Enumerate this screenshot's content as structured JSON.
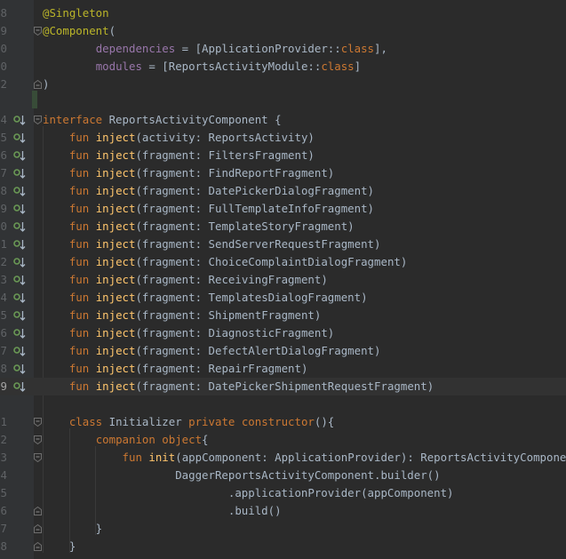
{
  "editor": {
    "lines": [
      {
        "num": "8",
        "tokens": [
          {
            "t": "@Singleton",
            "c": "anno"
          }
        ]
      },
      {
        "num": "9",
        "fold": "top",
        "tokens": [
          {
            "t": "@Component",
            "c": "anno"
          },
          {
            "t": "(",
            "c": "plain"
          }
        ]
      },
      {
        "num": "0",
        "tokens": [
          {
            "t": "        ",
            "c": "plain"
          },
          {
            "t": "dependencies",
            "c": "prop"
          },
          {
            "t": " = [ApplicationProvider::",
            "c": "plain"
          },
          {
            "t": "class",
            "c": "kw"
          },
          {
            "t": "],",
            "c": "plain"
          }
        ]
      },
      {
        "num": "0",
        "tokens": [
          {
            "t": "        ",
            "c": "plain"
          },
          {
            "t": "modules",
            "c": "prop"
          },
          {
            "t": " = [ReportsActivityModule::",
            "c": "plain"
          },
          {
            "t": "class",
            "c": "kw"
          },
          {
            "t": "]",
            "c": "plain"
          }
        ]
      },
      {
        "num": "2",
        "fold": "bottom",
        "tokens": [
          {
            "t": ")",
            "c": "plain"
          }
        ]
      },
      {
        "num": "",
        "tokens": []
      },
      {
        "num": "4",
        "impl": true,
        "fold": "top",
        "tokens": [
          {
            "t": "interface",
            "c": "kw"
          },
          {
            "t": " ReportsActivityComponent {",
            "c": "plain"
          }
        ]
      },
      {
        "num": "5",
        "impl": true,
        "tokens": [
          {
            "t": "    ",
            "c": "plain"
          },
          {
            "t": "fun",
            "c": "kw"
          },
          {
            "t": " ",
            "c": "plain"
          },
          {
            "t": "inject",
            "c": "fn"
          },
          {
            "t": "(activity: ReportsActivity)",
            "c": "plain"
          }
        ]
      },
      {
        "num": "6",
        "impl": true,
        "tokens": [
          {
            "t": "    ",
            "c": "plain"
          },
          {
            "t": "fun",
            "c": "kw"
          },
          {
            "t": " ",
            "c": "plain"
          },
          {
            "t": "inject",
            "c": "fn"
          },
          {
            "t": "(fragment: FiltersFragment)",
            "c": "plain"
          }
        ]
      },
      {
        "num": "7",
        "impl": true,
        "tokens": [
          {
            "t": "    ",
            "c": "plain"
          },
          {
            "t": "fun",
            "c": "kw"
          },
          {
            "t": " ",
            "c": "plain"
          },
          {
            "t": "inject",
            "c": "fn"
          },
          {
            "t": "(fragment: FindReportFragment)",
            "c": "plain"
          }
        ]
      },
      {
        "num": "8",
        "impl": true,
        "tokens": [
          {
            "t": "    ",
            "c": "plain"
          },
          {
            "t": "fun",
            "c": "kw"
          },
          {
            "t": " ",
            "c": "plain"
          },
          {
            "t": "inject",
            "c": "fn"
          },
          {
            "t": "(fragment: DatePickerDialogFragment)",
            "c": "plain"
          }
        ]
      },
      {
        "num": "9",
        "impl": true,
        "tokens": [
          {
            "t": "    ",
            "c": "plain"
          },
          {
            "t": "fun",
            "c": "kw"
          },
          {
            "t": " ",
            "c": "plain"
          },
          {
            "t": "inject",
            "c": "fn"
          },
          {
            "t": "(fragment: FullTemplateInfoFragment)",
            "c": "plain"
          }
        ]
      },
      {
        "num": "0",
        "impl": true,
        "tokens": [
          {
            "t": "    ",
            "c": "plain"
          },
          {
            "t": "fun",
            "c": "kw"
          },
          {
            "t": " ",
            "c": "plain"
          },
          {
            "t": "inject",
            "c": "fn"
          },
          {
            "t": "(fragment: TemplateStoryFragment)",
            "c": "plain"
          }
        ]
      },
      {
        "num": "1",
        "impl": true,
        "tokens": [
          {
            "t": "    ",
            "c": "plain"
          },
          {
            "t": "fun",
            "c": "kw"
          },
          {
            "t": " ",
            "c": "plain"
          },
          {
            "t": "inject",
            "c": "fn"
          },
          {
            "t": "(fragment: SendServerRequestFragment)",
            "c": "plain"
          }
        ]
      },
      {
        "num": "2",
        "impl": true,
        "tokens": [
          {
            "t": "    ",
            "c": "plain"
          },
          {
            "t": "fun",
            "c": "kw"
          },
          {
            "t": " ",
            "c": "plain"
          },
          {
            "t": "inject",
            "c": "fn"
          },
          {
            "t": "(fragment: ChoiceComplaintDialogFragment)",
            "c": "plain"
          }
        ]
      },
      {
        "num": "3",
        "impl": true,
        "tokens": [
          {
            "t": "    ",
            "c": "plain"
          },
          {
            "t": "fun",
            "c": "kw"
          },
          {
            "t": " ",
            "c": "plain"
          },
          {
            "t": "inject",
            "c": "fn"
          },
          {
            "t": "(fragment: ReceivingFragment)",
            "c": "plain"
          }
        ]
      },
      {
        "num": "4",
        "impl": true,
        "tokens": [
          {
            "t": "    ",
            "c": "plain"
          },
          {
            "t": "fun",
            "c": "kw"
          },
          {
            "t": " ",
            "c": "plain"
          },
          {
            "t": "inject",
            "c": "fn"
          },
          {
            "t": "(fragment: TemplatesDialogFragment)",
            "c": "plain"
          }
        ]
      },
      {
        "num": "5",
        "impl": true,
        "tokens": [
          {
            "t": "    ",
            "c": "plain"
          },
          {
            "t": "fun",
            "c": "kw"
          },
          {
            "t": " ",
            "c": "plain"
          },
          {
            "t": "inject",
            "c": "fn"
          },
          {
            "t": "(fragment: ShipmentFragment)",
            "c": "plain"
          }
        ]
      },
      {
        "num": "6",
        "impl": true,
        "tokens": [
          {
            "t": "    ",
            "c": "plain"
          },
          {
            "t": "fun",
            "c": "kw"
          },
          {
            "t": " ",
            "c": "plain"
          },
          {
            "t": "inject",
            "c": "fn"
          },
          {
            "t": "(fragment: DiagnosticFragment)",
            "c": "plain"
          }
        ]
      },
      {
        "num": "7",
        "impl": true,
        "tokens": [
          {
            "t": "    ",
            "c": "plain"
          },
          {
            "t": "fun",
            "c": "kw"
          },
          {
            "t": " ",
            "c": "plain"
          },
          {
            "t": "inject",
            "c": "fn"
          },
          {
            "t": "(fragment: DefectAlertDialogFragment)",
            "c": "plain"
          }
        ]
      },
      {
        "num": "8",
        "impl": true,
        "tokens": [
          {
            "t": "    ",
            "c": "plain"
          },
          {
            "t": "fun",
            "c": "kw"
          },
          {
            "t": " ",
            "c": "plain"
          },
          {
            "t": "inject",
            "c": "fn"
          },
          {
            "t": "(fragment: RepairFragment)",
            "c": "plain"
          }
        ]
      },
      {
        "num": "9",
        "impl": true,
        "current": true,
        "tokens": [
          {
            "t": "    ",
            "c": "plain"
          },
          {
            "t": "fun",
            "c": "kw"
          },
          {
            "t": " ",
            "c": "plain"
          },
          {
            "t": "inject",
            "c": "fn"
          },
          {
            "t": "(fragment: DatePickerShipmentRequestFragment)",
            "c": "plain"
          }
        ]
      },
      {
        "num": "",
        "tokens": []
      },
      {
        "num": "1",
        "fold": "top",
        "tokens": [
          {
            "t": "    ",
            "c": "plain"
          },
          {
            "t": "class",
            "c": "kw"
          },
          {
            "t": " Initializer ",
            "c": "plain"
          },
          {
            "t": "private constructor",
            "c": "kw"
          },
          {
            "t": "(){",
            "c": "plain"
          }
        ]
      },
      {
        "num": "2",
        "fold": "top",
        "tokens": [
          {
            "t": "        ",
            "c": "plain"
          },
          {
            "t": "companion object",
            "c": "kw"
          },
          {
            "t": "{",
            "c": "plain"
          }
        ]
      },
      {
        "num": "3",
        "fold": "top",
        "tokens": [
          {
            "t": "            ",
            "c": "plain"
          },
          {
            "t": "fun",
            "c": "kw"
          },
          {
            "t": " ",
            "c": "plain"
          },
          {
            "t": "init",
            "c": "fn"
          },
          {
            "t": "(appComponent: ApplicationProvider): ReportsActivityComponent =",
            "c": "plain"
          }
        ]
      },
      {
        "num": "4",
        "tokens": [
          {
            "t": "                    DaggerReportsActivityComponent.builder()",
            "c": "plain"
          }
        ]
      },
      {
        "num": "5",
        "tokens": [
          {
            "t": "                            .applicationProvider(appComponent)",
            "c": "plain"
          }
        ]
      },
      {
        "num": "6",
        "fold": "bottom",
        "tokens": [
          {
            "t": "                            .build()",
            "c": "plain"
          }
        ]
      },
      {
        "num": "7",
        "fold": "bottom",
        "tokens": [
          {
            "t": "        }",
            "c": "plain"
          }
        ]
      },
      {
        "num": "8",
        "fold": "bottom",
        "tokens": [
          {
            "t": "    }",
            "c": "plain"
          }
        ]
      }
    ]
  },
  "colors": {
    "background": "#2b2b2b",
    "gutter": "#313335",
    "current_line": "#323232",
    "keyword": "#cc7832",
    "annotation": "#bbb529",
    "function": "#ffc66d",
    "property": "#9876aa",
    "text": "#a9b7c6",
    "line_number": "#606366",
    "implementation_marker": "#6a9955"
  },
  "icons": {
    "implementation_marker": "implementing-method-icon",
    "fold_open": "fold-open-icon",
    "fold_close": "fold-close-icon"
  }
}
